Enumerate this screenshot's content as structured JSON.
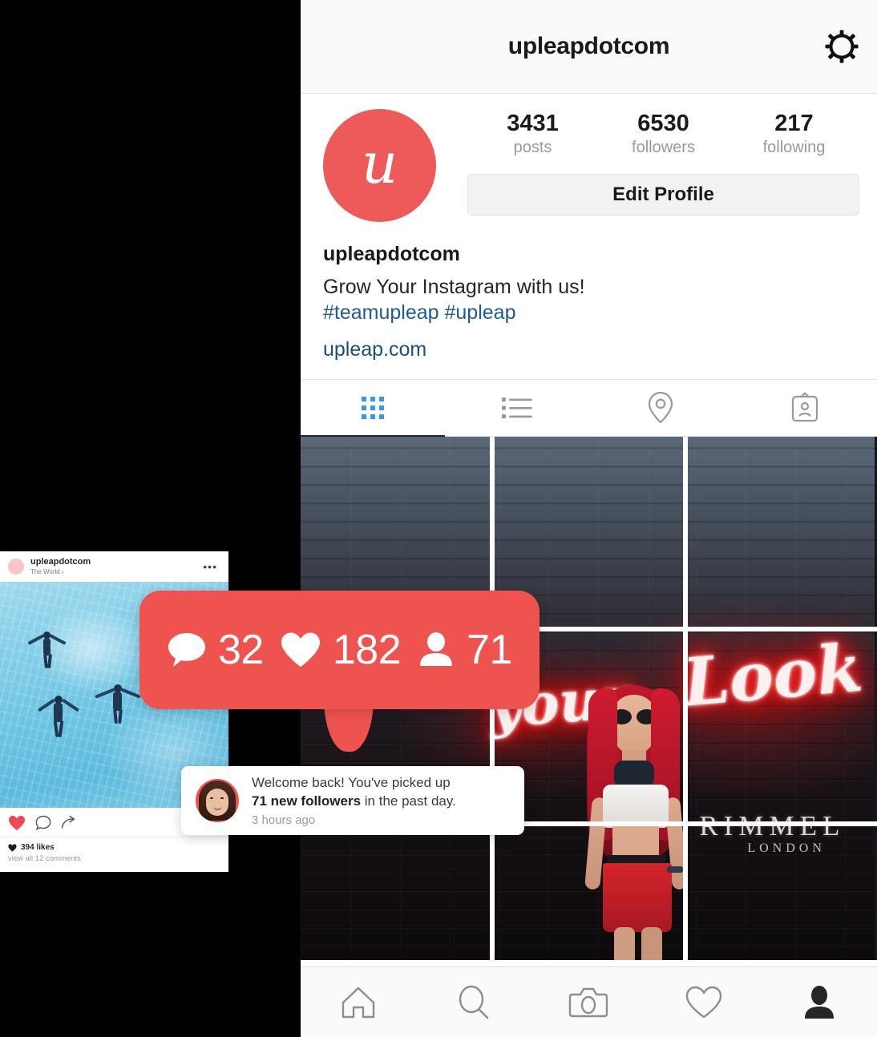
{
  "header": {
    "title": "upleapdotcom",
    "settings_icon": "gear-icon"
  },
  "profile": {
    "avatar_letter": "u",
    "avatar_color": "#ee5a5a",
    "stats": [
      {
        "value": "3431",
        "label": "posts"
      },
      {
        "value": "6530",
        "label": "followers"
      },
      {
        "value": "217",
        "label": "following"
      }
    ],
    "edit_profile_label": "Edit Profile",
    "name": "upleapdotcom",
    "bio": "Grow Your Instagram with us!",
    "hashtags": "#teamupleap #upleap",
    "website": "upleap.com"
  },
  "tabs": [
    {
      "name": "grid-tab",
      "icon": "grid-icon",
      "active": true
    },
    {
      "name": "list-tab",
      "icon": "list-icon",
      "active": false
    },
    {
      "name": "places-tab",
      "icon": "location-pin-icon",
      "active": false
    },
    {
      "name": "tagged-tab",
      "icon": "tagged-id-card-icon",
      "active": false
    }
  ],
  "grid": {
    "description": "Neon sign on dark brick wall reading your Look with RIMMEL LONDON branding and a model with red hair",
    "neon_text_1": "your",
    "neon_text_2": "Look",
    "brand": "RIMMEL",
    "brand_sub": "LONDON",
    "tiles": [
      "tile-1",
      "tile-2",
      "tile-3",
      "tile-4",
      "tile-5",
      "tile-6",
      "tile-7",
      "tile-8",
      "tile-9"
    ]
  },
  "bottom_nav": [
    {
      "name": "home-nav",
      "icon": "home-icon",
      "active": false
    },
    {
      "name": "search-nav",
      "icon": "search-icon",
      "active": false
    },
    {
      "name": "camera-nav",
      "icon": "camera-icon",
      "active": false
    },
    {
      "name": "activity-nav",
      "icon": "heart-icon",
      "active": false
    },
    {
      "name": "profile-nav",
      "icon": "person-icon",
      "active": true
    }
  ],
  "post_card": {
    "username": "upleapdotcom",
    "location": "The World ›",
    "more_label": "•••",
    "photo_description": "Aerial view of three people floating in turquoise water",
    "likes": "394 likes",
    "comments": "view all 12 comments",
    "icons": {
      "like": "heart-filled-icon",
      "comment": "comment-icon",
      "share": "share-arrow-icon"
    }
  },
  "bubble": {
    "background": "#ef5350",
    "items": [
      {
        "icon": "comment-bubble-icon",
        "count": "32"
      },
      {
        "icon": "heart-icon",
        "count": "182"
      },
      {
        "icon": "person-icon",
        "count": "71"
      }
    ]
  },
  "toast": {
    "message_prefix": "Welcome back! You've picked up",
    "message_bold": "71 new followers",
    "message_suffix": "in the past day.",
    "time": "3 hours ago",
    "avatar": "user-photo-avatar"
  }
}
